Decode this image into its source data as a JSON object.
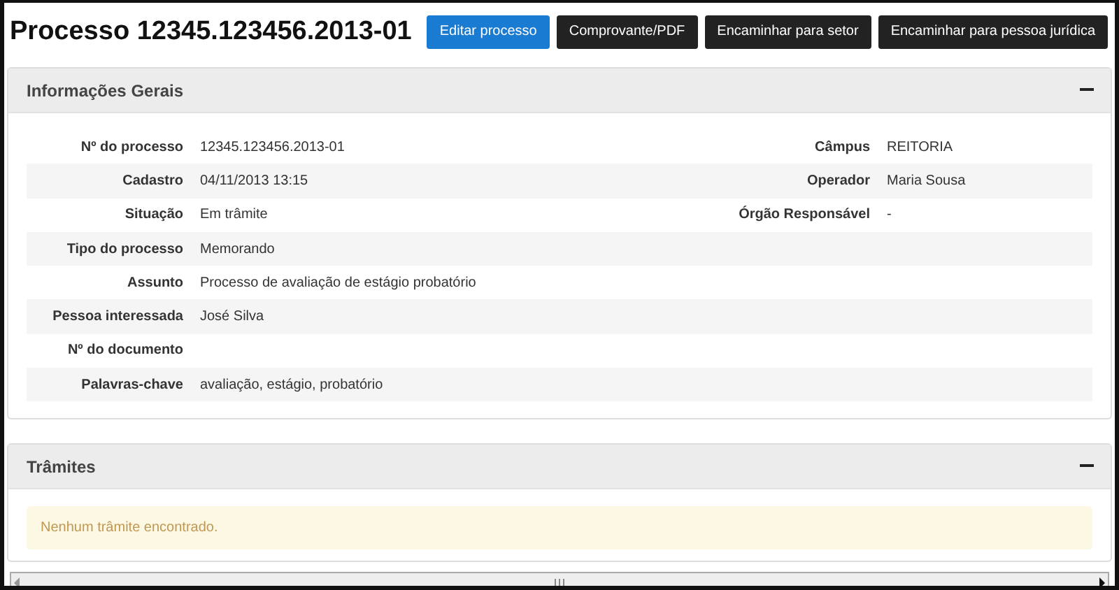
{
  "title": "Processo 12345.123456.2013-01",
  "buttons": [
    {
      "label": "Editar processo",
      "kind": "primary"
    },
    {
      "label": "Comprovante/PDF",
      "kind": "dark"
    },
    {
      "label": "Encaminhar para setor",
      "kind": "dark"
    },
    {
      "label": "Encaminhar para pessoa jurídica",
      "kind": "dark"
    }
  ],
  "general_panel": {
    "title": "Informações Gerais",
    "expanded": true,
    "rows": [
      {
        "label": "Nº do processo",
        "value": "12345.123456.2013-01",
        "right_label": "Câmpus",
        "right_value": "REITORIA"
      },
      {
        "label": "Cadastro",
        "value": "04/11/2013 13:15",
        "right_label": "Operador",
        "right_value": "Maria Sousa"
      },
      {
        "label": "Situação",
        "value": "Em trâmite",
        "right_label": "Órgão Responsável",
        "right_value": "-"
      },
      {
        "label": "Tipo do processo",
        "value": "Memorando"
      },
      {
        "label": "Assunto",
        "value": "Processo de avaliação de estágio probatório"
      },
      {
        "label": "Pessoa interessada",
        "value": "José Silva"
      },
      {
        "label": "Nº do documento"
      },
      {
        "label": "Palavras-chave",
        "value": "avaliação, estágio, probatório"
      }
    ]
  },
  "tramites_panel": {
    "title": "Trâmites",
    "expanded": true,
    "message": "Nenhum trâmite encontrado."
  }
}
